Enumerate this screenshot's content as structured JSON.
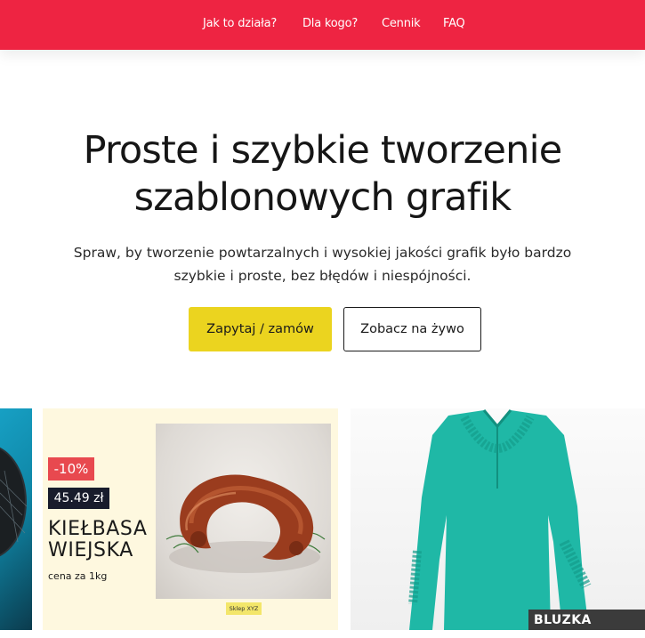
{
  "nav": {
    "items": [
      {
        "label": "Jak to działa?"
      },
      {
        "label": "Dla kogo?"
      },
      {
        "label": "Cennik"
      },
      {
        "label": "FAQ"
      }
    ]
  },
  "hero": {
    "title": "Proste i szybkie tworzenie szablonowych grafik",
    "subtitle": "Spraw, by tworzenie powtarzalnych i wysokiej jakości grafik było bardzo szybkie i proste, bez błędów i niespójności.",
    "primary_button": "Zapytaj / zamów",
    "secondary_button": "Zobacz na żywo"
  },
  "gallery": {
    "product_card": {
      "discount": "-10%",
      "price": "45.49 zł",
      "name": "KIEŁBASA WIEJSKA",
      "unit": "cena za 1kg",
      "shop": "Sklep XYZ"
    },
    "shirt_card": {
      "label": "BLUZKA"
    }
  },
  "colors": {
    "nav_bg": "#ee2442",
    "primary_button": "#ebd41f",
    "discount_badge": "#e8494f",
    "price_badge": "#181c2c",
    "product_card_bg": "#fef8df",
    "shirt": "#1fb8a6"
  }
}
